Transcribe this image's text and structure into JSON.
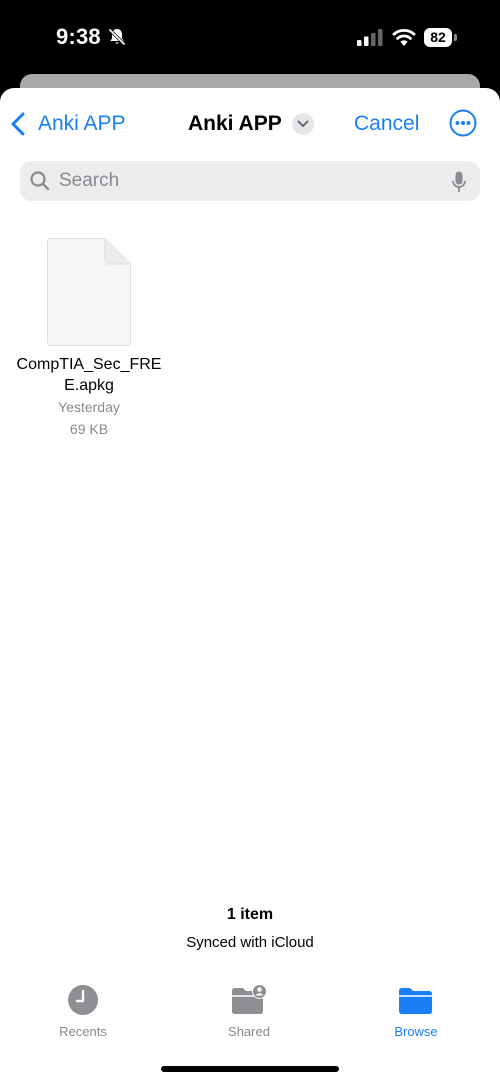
{
  "status_bar": {
    "time": "9:38",
    "battery": "82"
  },
  "nav": {
    "back_label": "Anki APP",
    "title": "Anki APP",
    "cancel_label": "Cancel"
  },
  "search": {
    "placeholder": "Search",
    "value": ""
  },
  "files": [
    {
      "name": "CompTIA_Sec_FREE.apkg",
      "date": "Yesterday",
      "size": "69 KB"
    }
  ],
  "footer": {
    "item_count": "1 item",
    "sync_status": "Synced with iCloud"
  },
  "tabs": [
    {
      "label": "Recents",
      "icon": "clock-icon",
      "active": false
    },
    {
      "label": "Shared",
      "icon": "shared-folder-icon",
      "active": false
    },
    {
      "label": "Browse",
      "icon": "folder-icon",
      "active": true
    }
  ],
  "colors": {
    "accent": "#1a7ff5",
    "secondary_text": "#8a8a8e",
    "inactive_icon": "#8e8e93"
  }
}
